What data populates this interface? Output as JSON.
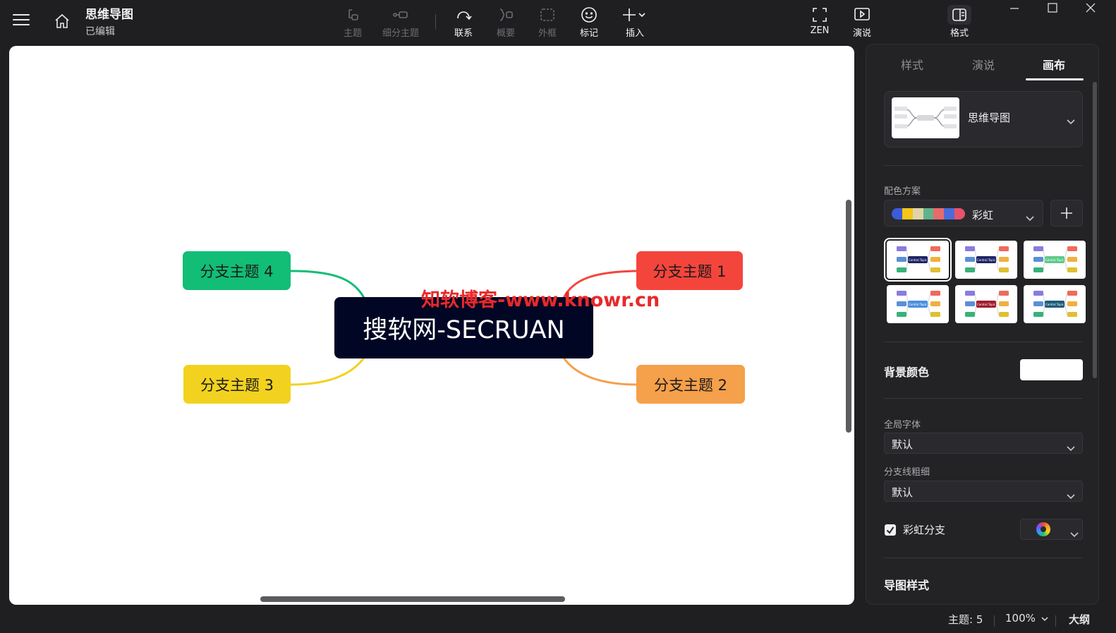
{
  "app": {
    "title": "思维导图",
    "status": "已编辑"
  },
  "toolbar": {
    "items": [
      {
        "id": "topic",
        "label": "主题",
        "icon": "topic-icon",
        "enabled": false
      },
      {
        "id": "subtopic",
        "label": "细分主题",
        "icon": "subtopic-icon",
        "enabled": false
      },
      {
        "id": "relationship",
        "label": "联系",
        "icon": "relationship-icon",
        "enabled": true
      },
      {
        "id": "summary",
        "label": "概要",
        "icon": "summary-icon",
        "enabled": false
      },
      {
        "id": "boundary",
        "label": "外框",
        "icon": "boundary-icon",
        "enabled": false
      },
      {
        "id": "marker",
        "label": "标记",
        "icon": "smiley-icon",
        "enabled": true
      },
      {
        "id": "insert",
        "label": "插入",
        "icon": "plus-icon",
        "enabled": true
      },
      {
        "id": "zen",
        "label": "ZEN",
        "icon": "fullscreen-icon",
        "enabled": true
      },
      {
        "id": "pitch",
        "label": "演说",
        "icon": "play-icon",
        "enabled": true
      },
      {
        "id": "format",
        "label": "格式",
        "icon": "panel-icon",
        "enabled": true
      }
    ]
  },
  "mindmap": {
    "central": "搜软网-SECRUAN",
    "branches": [
      {
        "label": "分支主题 1",
        "color": "#f4453c",
        "side": "right"
      },
      {
        "label": "分支主题 2",
        "color": "#f5a04a",
        "side": "right"
      },
      {
        "label": "分支主题 3",
        "color": "#f2d21f",
        "side": "left"
      },
      {
        "label": "分支主题 4",
        "color": "#12bd76",
        "side": "left"
      }
    ],
    "watermark": "知软博客-www.knowr.cn"
  },
  "panel": {
    "tabs": [
      {
        "label": "样式",
        "active": false
      },
      {
        "label": "演说",
        "active": false
      },
      {
        "label": "画布",
        "active": true
      }
    ],
    "structure": "思维导图",
    "color_scheme_label": "配色方案",
    "color_scheme_name": "彩虹",
    "color_scheme_colors": [
      "#3c5bd6",
      "#f5c518",
      "#e0d4a8",
      "#5fb38a",
      "#e86b6b",
      "#4b6cd8",
      "#e8526b"
    ],
    "theme_thumbnails": [
      {
        "center": "#1e2466",
        "selected": true
      },
      {
        "center": "#1e2466",
        "selected": false
      },
      {
        "center": "#5fc98a",
        "selected": false
      },
      {
        "center": "#4b8fe0",
        "selected": false
      },
      {
        "center": "#a01c2c",
        "selected": false
      },
      {
        "center": "#1e5a7a",
        "selected": false
      }
    ],
    "thumb_center_text": "Central Topic",
    "bg_color_label": "背景颜色",
    "bg_color": "#ffffff",
    "global_font_label": "全局字体",
    "global_font_value": "默认",
    "branch_width_label": "分支线粗细",
    "branch_width_value": "默认",
    "rainbow_branch_label": "彩虹分支",
    "rainbow_branch_checked": true,
    "map_style_label": "导图样式"
  },
  "statusbar": {
    "topics": "主题: 5",
    "zoom": "100%",
    "outline": "大纲"
  }
}
